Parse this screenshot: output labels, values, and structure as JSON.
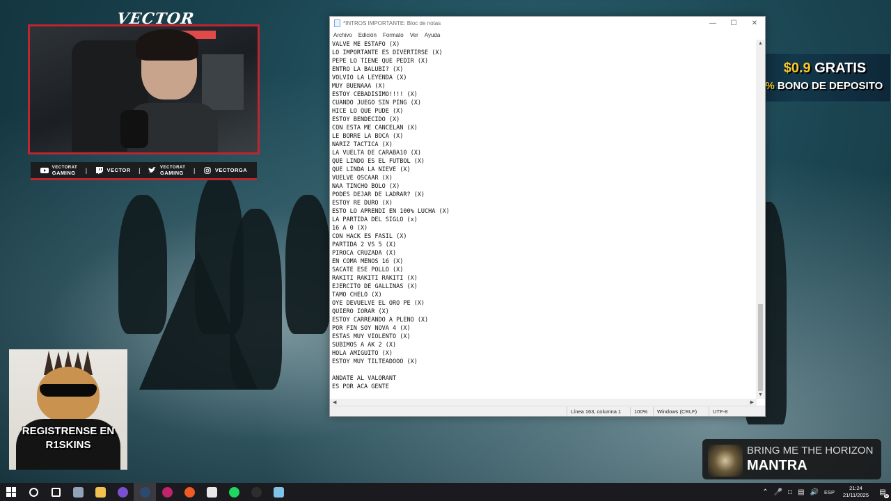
{
  "overlay": {
    "brand": "VECTOR",
    "socials": [
      {
        "icon": "youtube-icon",
        "line1": "VECTORAT",
        "line2": "GAMING"
      },
      {
        "icon": "twitch-icon",
        "line1": "VECTOR",
        "line2": ""
      },
      {
        "icon": "twitter-icon",
        "line1": "VECTORAT",
        "line2": "GAMING"
      },
      {
        "icon": "instagram-icon",
        "line1": "VECTORGA",
        "line2": ""
      }
    ],
    "ad": {
      "amount": "$0.9",
      "gratis": "GRATIS",
      "plus": "+ 10%",
      "bono": "BONO DE DEPOSITO",
      "accent": "#f8c62a"
    },
    "cat_text_1": "REGISTRENSE EN",
    "cat_text_2": "R1SKINS",
    "music": {
      "artist": "BRING ME THE HORIZON",
      "title": "MANTRA"
    },
    "accent_color": "#c0242f"
  },
  "notepad": {
    "title": "*INTROS IMPORTANTE: Bloc de notas",
    "menu": [
      "Archivo",
      "Edición",
      "Formato",
      "Ver",
      "Ayuda"
    ],
    "lines": [
      "VALVE ME ESTAFO (X)",
      "LO IMPORTANTE ES DIVERTIRSE (X)",
      "PEPE LO TIENE QUE PEDIR (X)",
      "ENTRO LA BALUBI? (X)",
      "VOLVIO LA LEYENDA (X)",
      "MUY BUENAAA (X)",
      "ESTOY CEBADISIMO!!!! (X)",
      "CUANDO JUEGO SIN PING (X)",
      "HICE LO QUE PUDE (X)",
      "ESTOY BENDECIDO (X)",
      "CON ESTA ME CANCELAN (X)",
      "LE BORRE LA BOCA (X)",
      "NARIZ TACTICA (X)",
      "LA VUELTA DE CARABA10 (X)",
      "QUE LINDO ES EL FUTBOL (X)",
      "QUE LINDA LA NIEVE (X)",
      "VUELVE OSCAAR (X)",
      "NAA TINCHO BOLO (X)",
      "PODES DEJAR DE LADRAR? (X)",
      "ESTOY RE DURO (X)",
      "ESTO LO APRENDI EN 100% LUCHA (X)",
      "LA PARTIDA DEL SIGLO (x)",
      "16 A 0 (X)",
      "CON HACK ES FASIL (X)",
      "PARTIDA 2 VS 5 (X)",
      "PIROCA CRUZADA (X)",
      "EN COMA MENOS 16 (X)",
      "SACATE ESE POLLO (X)",
      "RAKITI RAKITI RAKITI (X)",
      "EJERCITO DE GALLINAS (X)",
      "TAMO CHELO (X)",
      "OYE DEVUELVE EL ORO PE (X)",
      "QUIERO IORAR (X)",
      "ESTOY CARREANDO A PLENO (X)",
      "POR FIN SOY NOVA 4 (X)",
      "ESTAS MUY VIOLENTO (X)",
      "SUBIMOS A AK 2 (X)",
      "HOLA AMIGUITO (X)",
      "ESTOY MUY TILTEADOOO (X)",
      "",
      "ANDATE AL VALORANT",
      "ES POR ACA GENTE"
    ],
    "status": {
      "position": "Línea 163, columna 1",
      "zoom": "100%",
      "eol": "Windows (CRLF)",
      "encoding": "UTF-8"
    }
  },
  "taskbar": {
    "apps": [
      {
        "name": "taskbar-search-icon",
        "color": "#ffffff"
      },
      {
        "name": "taskbar-taskview-icon",
        "color": "#ffffff"
      },
      {
        "name": "taskbar-app-icon",
        "color": "#8fa4b8"
      },
      {
        "name": "taskbar-explorer-icon",
        "color": "#f2c14e"
      },
      {
        "name": "taskbar-discord-icon",
        "color": "#7a4fd0"
      },
      {
        "name": "taskbar-steam-icon",
        "color": "#2a4b6e"
      },
      {
        "name": "taskbar-obs-icon",
        "color": "#c0246a"
      },
      {
        "name": "taskbar-brave-icon",
        "color": "#f15a24"
      },
      {
        "name": "taskbar-game-icon",
        "color": "#e8e8e8"
      },
      {
        "name": "taskbar-spotify-icon",
        "color": "#1ed760"
      },
      {
        "name": "taskbar-app2-icon",
        "color": "#2e2e2e"
      },
      {
        "name": "taskbar-notepad-icon",
        "color": "#7fc4e8"
      }
    ],
    "language": "ESP",
    "time": "21:24",
    "date": "21/11/2025",
    "notifications": "6"
  }
}
